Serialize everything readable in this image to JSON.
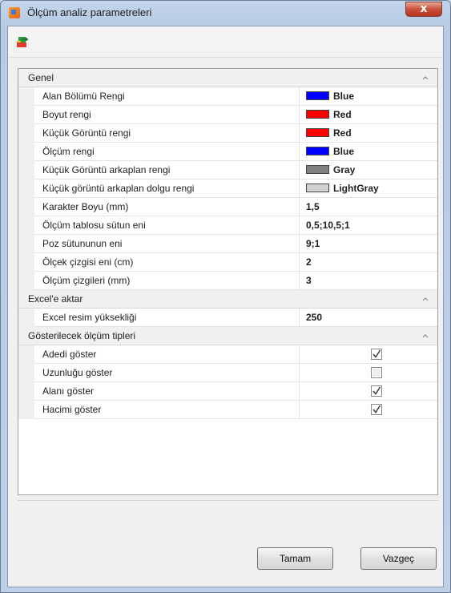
{
  "window": {
    "title": "Ölçüm analiz parametreleri",
    "close_label": "x"
  },
  "colors": {
    "blue": "#0000ff",
    "red": "#ff0000",
    "gray": "#808080",
    "lightgray": "#d3d3d3"
  },
  "categories": [
    {
      "label": "Genel"
    },
    {
      "label": "Excel'e aktar"
    },
    {
      "label": "Gösterilecek ölçüm tipleri"
    }
  ],
  "general": [
    {
      "name": "Alan Bölümü Rengi",
      "value": "Blue",
      "color": "#0000ff"
    },
    {
      "name": "Boyut rengi",
      "value": "Red",
      "color": "#ff0000"
    },
    {
      "name": "Küçük Görüntü rengi",
      "value": "Red",
      "color": "#ff0000"
    },
    {
      "name": "Ölçüm rengi",
      "value": "Blue",
      "color": "#0000ff"
    },
    {
      "name": "Küçük Görüntü arkaplan rengi",
      "value": "Gray",
      "color": "#808080"
    },
    {
      "name": "Küçük görüntü arkaplan dolgu rengi",
      "value": "LightGray",
      "color": "#d3d3d3"
    },
    {
      "name": "Karakter Boyu (mm)",
      "value": "1,5"
    },
    {
      "name": "Ölçüm tablosu sütun eni",
      "value": "0,5;10,5;1"
    },
    {
      "name": "Poz sütununun eni",
      "value": "9;1"
    },
    {
      "name": "Ölçek çizgisi eni (cm)",
      "value": "2"
    },
    {
      "name": "Ölçüm çizgileri (mm)",
      "value": "3"
    }
  ],
  "excel": [
    {
      "name": "Excel resim yüksekliği",
      "value": "250"
    }
  ],
  "types": [
    {
      "name": "Adedi göster",
      "checked": true
    },
    {
      "name": "Uzunluğu göster",
      "checked": false
    },
    {
      "name": "Alanı göster",
      "checked": true
    },
    {
      "name": "Hacimi göster",
      "checked": true
    }
  ],
  "buttons": {
    "ok": "Tamam",
    "cancel": "Vazgeç"
  }
}
